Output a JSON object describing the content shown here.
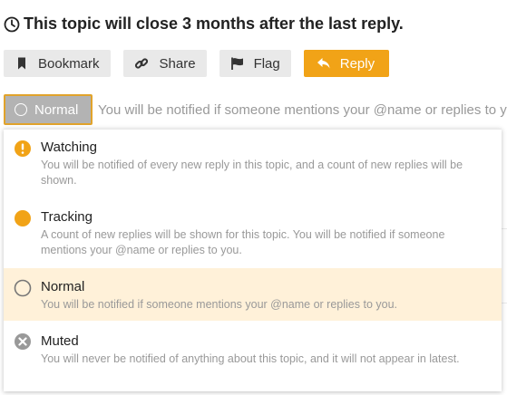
{
  "topic": {
    "close_notice": "This topic will close 3 months after the last reply."
  },
  "actions": {
    "bookmark": "Bookmark",
    "share": "Share",
    "flag": "Flag",
    "reply": "Reply"
  },
  "notifications": {
    "current_level": "Normal",
    "current_description": "You will be notified if someone mentions your @name or replies to you.",
    "options": [
      {
        "title": "Watching",
        "description": "You will be notified of every new reply in this topic, and a count of new replies will be shown.",
        "icon": "exclamation-circle-icon"
      },
      {
        "title": "Tracking",
        "description": "A count of new replies will be shown for this topic. You will be notified if someone mentions your @name or replies to you.",
        "icon": "filled-circle-icon"
      },
      {
        "title": "Normal",
        "description": "You will be notified if someone mentions your @name or replies to you.",
        "icon": "empty-circle-icon"
      },
      {
        "title": "Muted",
        "description": "You will never be notified of anything about this topic, and it will not appear in latest.",
        "icon": "times-circle-icon"
      }
    ]
  },
  "colors": {
    "accent": "#f1a317",
    "selected_bg": "#fff1d9",
    "button_bg": "#e9e9e9",
    "muted_text": "#999999"
  }
}
